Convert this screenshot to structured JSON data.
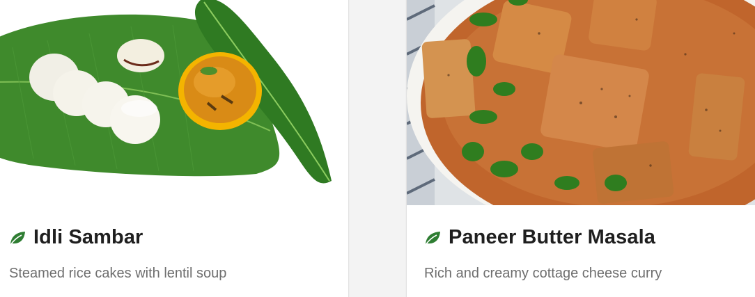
{
  "accent_color": "#2e7d32",
  "cards": [
    {
      "image_name": "idli-sambar-photo",
      "icon": "leaf-icon",
      "title": "Idli Sambar",
      "description": "Steamed rice cakes with lentil soup"
    },
    {
      "image_name": "paneer-butter-masala-photo",
      "icon": "leaf-icon",
      "title": "Paneer Butter Masala",
      "description": "Rich and creamy cottage cheese curry"
    }
  ]
}
